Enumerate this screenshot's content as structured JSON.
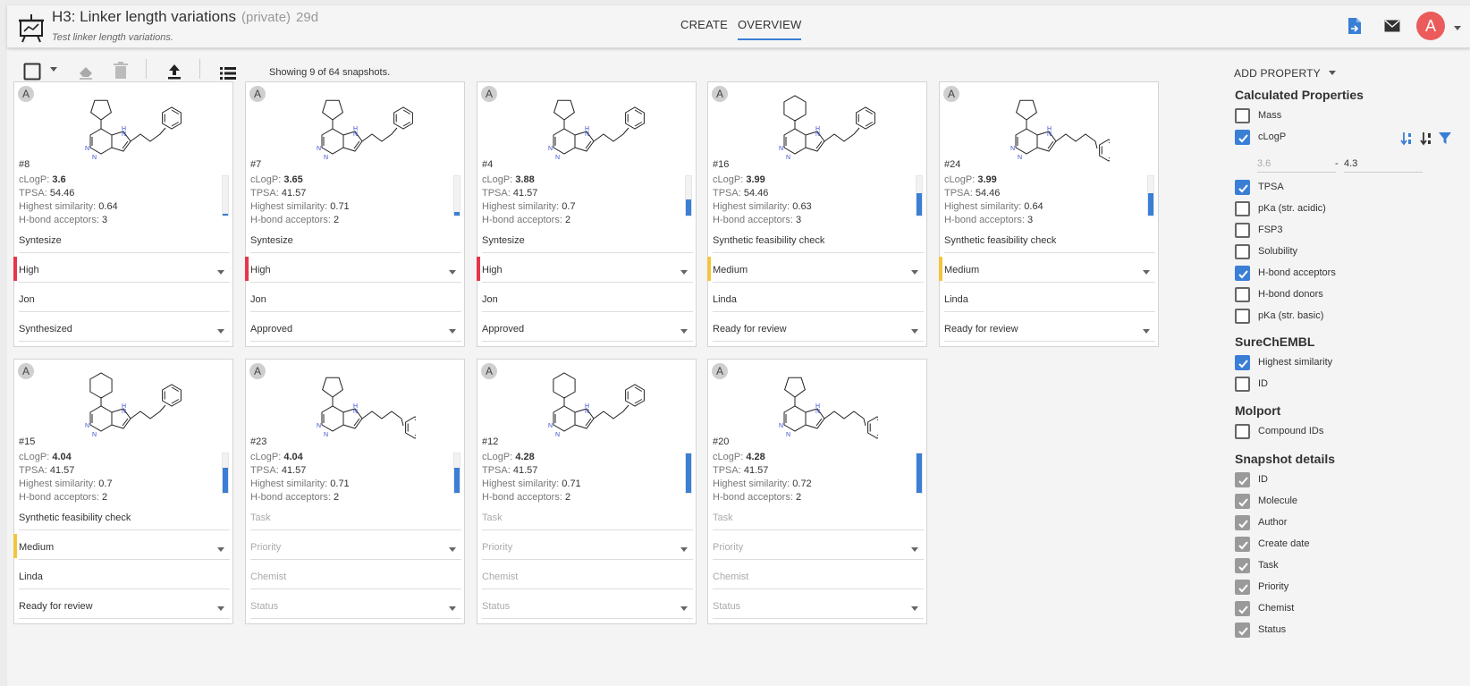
{
  "header": {
    "title": "H3: Linker length variations",
    "visibility": "(private)",
    "age": "29d",
    "subtitle": "Test linker length variations.",
    "tabs": [
      {
        "label": "CREATE"
      },
      {
        "label": "OVERVIEW"
      }
    ],
    "active_tab": "OVERVIEW",
    "avatar_letter": "A",
    "avatar_color": "#ec5b5b"
  },
  "toolbar": {
    "showing_text": "Showing 9 of 64 snapshots.",
    "add_property_label": "ADD PROPERTY"
  },
  "prop_labels": {
    "clogp": "cLogP",
    "tpsa": "TPSA",
    "sim": "Highest similarity",
    "hba": "H-bond acceptors"
  },
  "cards": [
    {
      "badge": "A",
      "id": "#8",
      "clogp": "3.6",
      "tpsa": "54.46",
      "sim": "0.64",
      "hba": "3",
      "bar_fraction": 0.05,
      "task": "Syntesize",
      "priority": "High",
      "priority_color": "#e8354a",
      "chemist": "Jon",
      "status": "Synthesized",
      "ring": "cyclopentyl",
      "linker": 3
    },
    {
      "badge": "A",
      "id": "#7",
      "clogp": "3.65",
      "tpsa": "41.57",
      "sim": "0.71",
      "hba": "2",
      "bar_fraction": 0.1,
      "task": "Syntesize",
      "priority": "High",
      "priority_color": "#e8354a",
      "chemist": "Jon",
      "status": "Approved",
      "ring": "cyclopentyl",
      "linker": 3
    },
    {
      "badge": "A",
      "id": "#4",
      "clogp": "3.88",
      "tpsa": "41.57",
      "sim": "0.7",
      "hba": "2",
      "bar_fraction": 0.42,
      "task": "Syntesize",
      "priority": "High",
      "priority_color": "#e8354a",
      "chemist": "Jon",
      "status": "Approved",
      "ring": "cyclopentyl",
      "linker": 3
    },
    {
      "badge": "A",
      "id": "#16",
      "clogp": "3.99",
      "tpsa": "54.46",
      "sim": "0.63",
      "hba": "3",
      "bar_fraction": 0.57,
      "task": "Synthetic feasibility check",
      "priority": "Medium",
      "priority_color": "#f2c53d",
      "chemist": "Linda",
      "status": "Ready for review",
      "ring": "cyclohexyl",
      "linker": 3
    },
    {
      "badge": "A",
      "id": "#24",
      "clogp": "3.99",
      "tpsa": "54.46",
      "sim": "0.64",
      "hba": "3",
      "bar_fraction": 0.57,
      "task": "Synthetic feasibility check",
      "priority": "Medium",
      "priority_color": "#f2c53d",
      "chemist": "Linda",
      "status": "Ready for review",
      "ring": "cyclopentyl",
      "linker": 4
    },
    {
      "badge": "A",
      "id": "#15",
      "clogp": "4.04",
      "tpsa": "41.57",
      "sim": "0.7",
      "hba": "2",
      "bar_fraction": 0.64,
      "task": "Synthetic feasibility check",
      "priority": "Medium",
      "priority_color": "#f2c53d",
      "chemist": "Linda",
      "status": "Ready for review",
      "ring": "cyclohexyl",
      "linker": 3
    },
    {
      "badge": "A",
      "id": "#23",
      "clogp": "4.04",
      "tpsa": "41.57",
      "sim": "0.71",
      "hba": "2",
      "bar_fraction": 0.64,
      "task": "Task",
      "priority": "Priority",
      "priority_color": "",
      "chemist": "Chemist",
      "status": "Status",
      "placeholder": true,
      "ring": "cyclopentyl",
      "linker": 4
    },
    {
      "badge": "A",
      "id": "#12",
      "clogp": "4.28",
      "tpsa": "41.57",
      "sim": "0.71",
      "hba": "2",
      "bar_fraction": 1.0,
      "task": "Task",
      "priority": "Priority",
      "priority_color": "",
      "chemist": "Chemist",
      "status": "Status",
      "placeholder": true,
      "ring": "cyclohexyl",
      "linker": 3
    },
    {
      "badge": "A",
      "id": "#20",
      "clogp": "4.28",
      "tpsa": "41.57",
      "sim": "0.72",
      "hba": "2",
      "bar_fraction": 1.0,
      "task": "Task",
      "priority": "Priority",
      "priority_color": "",
      "chemist": "Chemist",
      "status": "Status",
      "placeholder": true,
      "ring": "cyclopentyl",
      "linker": 4
    }
  ],
  "panel": {
    "calc_title": "Calculated Properties",
    "calc_items": [
      {
        "label": "Mass",
        "checked": false
      },
      {
        "label": "cLogP",
        "checked": true
      },
      {
        "label": "TPSA",
        "checked": true
      },
      {
        "label": "pKa (str. acidic)",
        "checked": false
      },
      {
        "label": "FSP3",
        "checked": false
      },
      {
        "label": "Solubility",
        "checked": false
      },
      {
        "label": "H-bond acceptors",
        "checked": true
      },
      {
        "label": "H-bond donors",
        "checked": false
      },
      {
        "label": "pKa (str. basic)",
        "checked": false
      }
    ],
    "clogp_range_min": "3.6",
    "clogp_range_sep": "-",
    "clogp_range_max": "4.3",
    "surechembl_title": "SureChEMBL",
    "surechembl_items": [
      {
        "label": "Highest similarity",
        "checked": true
      },
      {
        "label": "ID",
        "checked": false
      }
    ],
    "molport_title": "Molport",
    "molport_items": [
      {
        "label": "Compound IDs",
        "checked": false
      }
    ],
    "snapshot_title": "Snapshot details",
    "snapshot_items": [
      {
        "label": "ID"
      },
      {
        "label": "Molecule"
      },
      {
        "label": "Author"
      },
      {
        "label": "Create date"
      },
      {
        "label": "Task"
      },
      {
        "label": "Priority"
      },
      {
        "label": "Chemist"
      },
      {
        "label": "Status"
      }
    ],
    "accent": "#3a7fd5"
  }
}
